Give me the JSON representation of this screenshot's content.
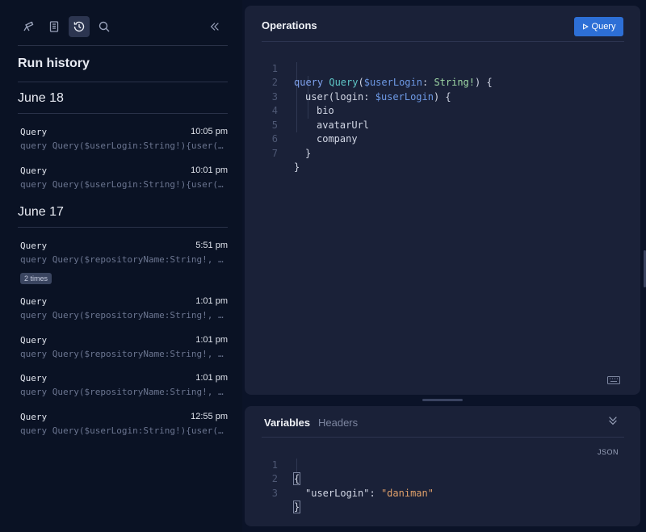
{
  "toolbar": {
    "icons": [
      "explorer-icon",
      "docs-icon",
      "history-icon",
      "search-icon"
    ],
    "active": "history-icon",
    "collapse_icon": "double-chevron-left-icon"
  },
  "sidebar": {
    "title": "Run history",
    "groups": [
      {
        "label": "June 18",
        "entries": [
          {
            "name": "Query",
            "time": "10:05 pm",
            "preview": "query Query($userLogin:String!){user(login:$userLogin){bio avatarUrl company}}",
            "badge": ""
          },
          {
            "name": "Query",
            "time": "10:01 pm",
            "preview": "query Query($userLogin:String!){user(login:$userLogin){bio avatarUrl company}}",
            "badge": ""
          }
        ]
      },
      {
        "label": "June 17",
        "entries": [
          {
            "name": "Query",
            "time": "5:51 pm",
            "preview": "query Query($repositoryName:String!, $owner:String!){repository(name:$repositoryName, owner:$owner)}",
            "badge": "2 times"
          },
          {
            "name": "Query",
            "time": "1:01 pm",
            "preview": "query Query($repositoryName:String!, $owner:String!){repository(name:$repositoryName, owner:$owner)}",
            "badge": ""
          },
          {
            "name": "Query",
            "time": "1:01 pm",
            "preview": "query Query($repositoryName:String!, $owner:String!){repository(name:$repositoryName, owner:$owner)}",
            "badge": ""
          },
          {
            "name": "Query",
            "time": "1:01 pm",
            "preview": "query Query($repositoryName:String!, $owner:String!){repository(name:$repositoryName, owner:$owner)}",
            "badge": ""
          },
          {
            "name": "Query",
            "time": "12:55 pm",
            "preview": "query Query($userLogin:String!){user(login:$userLogin){bio avatarUrl company}}",
            "badge": ""
          }
        ]
      }
    ]
  },
  "operations": {
    "title": "Operations",
    "run_label": "Query",
    "run_icon": "play-icon",
    "line_numbers": [
      "1",
      "2",
      "3",
      "4",
      "5",
      "6",
      "7"
    ],
    "code": {
      "l1_kw": "query",
      "l1_name": "Query",
      "l1_var": "$userLogin",
      "l1_colon": ":",
      "l1_type": "String!",
      "l1_end": ") {",
      "l2_field": "user(login:",
      "l2_var": "$userLogin",
      "l2_end": ") {",
      "l3": "bio",
      "l4": "avatarUrl",
      "l5": "company",
      "l6": "}",
      "l7": "}"
    },
    "keyboard_icon": "keyboard-icon"
  },
  "variables": {
    "tabs": [
      "Variables",
      "Headers"
    ],
    "active_tab": "Variables",
    "format_label": "JSON",
    "collapse_icon": "double-chevron-down-icon",
    "line_numbers": [
      "1",
      "2",
      "3"
    ],
    "code": {
      "open": "{",
      "key": "\"userLogin\"",
      "sep": ":",
      "value": "\"daniman\"",
      "close": "}"
    }
  },
  "colors": {
    "background": "#0b1328",
    "panel": "#1a2138",
    "accent": "#2d6fd6",
    "keyword": "#7fa2ee",
    "string": "#e0a06a"
  }
}
